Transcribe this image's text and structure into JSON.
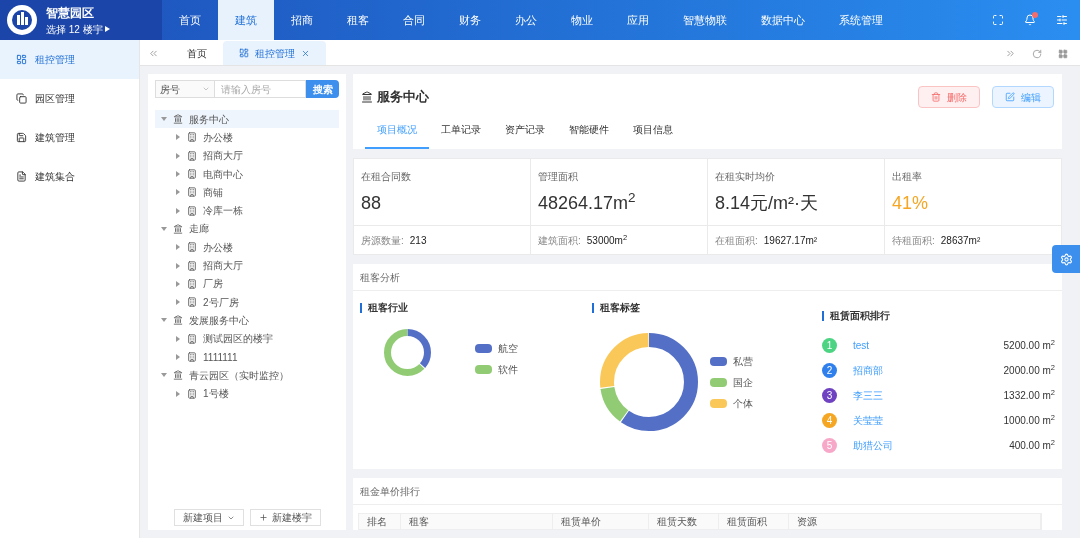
{
  "app": {
    "title": "智慧园区",
    "subtitle": "选择 12 楼宇"
  },
  "top_nav": [
    {
      "label": "首页",
      "selected": false
    },
    {
      "label": "建筑",
      "selected": true
    },
    {
      "label": "招商",
      "selected": false
    },
    {
      "label": "租客",
      "selected": false
    },
    {
      "label": "合同",
      "selected": false
    },
    {
      "label": "财务",
      "selected": false
    },
    {
      "label": "办公",
      "selected": false
    },
    {
      "label": "物业",
      "selected": false
    },
    {
      "label": "应用",
      "selected": false
    },
    {
      "label": "智慧物联",
      "selected": false
    },
    {
      "label": "数据中心",
      "selected": false
    },
    {
      "label": "系统管理",
      "selected": false
    }
  ],
  "notification_dot": true,
  "sidebar": {
    "items": [
      {
        "label": "租控管理",
        "selected": true
      },
      {
        "label": "园区管理",
        "selected": false
      },
      {
        "label": "建筑管理",
        "selected": false
      },
      {
        "label": "建筑集合",
        "selected": false
      }
    ]
  },
  "page_tabs": [
    {
      "label": "首页",
      "selected": false,
      "closable": false
    },
    {
      "label": "租控管理",
      "selected": true,
      "closable": true
    }
  ],
  "tree_panel": {
    "search_type": "房号",
    "search_placeholder": "请输入房号",
    "search_button": "搜索",
    "tree": [
      {
        "label": "服务中心",
        "kind": "project",
        "expanded": true,
        "selected": true,
        "children": [
          {
            "label": "办公楼",
            "kind": "building",
            "expanded": false,
            "selected": false
          },
          {
            "label": "招商大厅",
            "kind": "building",
            "expanded": false,
            "selected": false
          },
          {
            "label": "电商中心",
            "kind": "building",
            "expanded": false,
            "selected": false
          },
          {
            "label": "商铺",
            "kind": "building",
            "expanded": false,
            "selected": false
          },
          {
            "label": "冷库一栋",
            "kind": "building",
            "expanded": false,
            "selected": false
          }
        ]
      },
      {
        "label": "走廊",
        "kind": "project",
        "expanded": true,
        "selected": false,
        "children": [
          {
            "label": "办公楼",
            "kind": "building",
            "expanded": false,
            "selected": false
          },
          {
            "label": "招商大厅",
            "kind": "building",
            "expanded": false,
            "selected": false
          },
          {
            "label": "厂房",
            "kind": "building",
            "expanded": false,
            "selected": false
          },
          {
            "label": "2号厂房",
            "kind": "building",
            "expanded": false,
            "selected": false
          }
        ]
      },
      {
        "label": "发展服务中心",
        "kind": "project",
        "expanded": true,
        "selected": false,
        "children": [
          {
            "label": "测试园区的楼宇",
            "kind": "building",
            "expanded": false,
            "selected": false
          },
          {
            "label": "1111111",
            "kind": "building",
            "expanded": false,
            "selected": false
          }
        ]
      },
      {
        "label": "青云园区（实时监控）",
        "kind": "project",
        "expanded": true,
        "selected": false,
        "children": [
          {
            "label": "1号楼",
            "kind": "building",
            "expanded": false,
            "selected": false
          }
        ]
      }
    ],
    "buttons": [
      {
        "label": "新建项目",
        "kind": "dropdown"
      },
      {
        "label": "新建楼宇",
        "kind": "add"
      }
    ]
  },
  "detail": {
    "title": "服务中心",
    "actions": [
      {
        "label": "删除",
        "kind": "danger"
      },
      {
        "label": "编辑",
        "kind": "primary"
      }
    ],
    "tabs": [
      {
        "label": "项目概况",
        "selected": true
      },
      {
        "label": "工单记录",
        "selected": false
      },
      {
        "label": "资产记录",
        "selected": false
      },
      {
        "label": "智能硬件",
        "selected": false
      },
      {
        "label": "项目信息",
        "selected": false
      }
    ],
    "stats": [
      {
        "label": "在租合同数",
        "value": "88",
        "highlight": false,
        "sub_label": "房源数量:",
        "sub_value": "213"
      },
      {
        "label": "管理面积",
        "value": "48264.17m$^{2}$",
        "highlight": false,
        "sub_label": "建筑面积:",
        "sub_value": "53000m$^{2}$"
      },
      {
        "label": "在租实时均价",
        "value": "8.14元/m²·天",
        "highlight": false,
        "sub_label": "在租面积:",
        "sub_value": "19627.17m²"
      },
      {
        "label": "出租率",
        "value": "41%",
        "highlight": true,
        "sub_label": "待租面积:",
        "sub_value": "28637m²"
      }
    ],
    "analysis": {
      "title": "租客分析",
      "industry": {
        "title": "租客行业",
        "legend": [
          {
            "label": "航空",
            "color": "#5470c6"
          },
          {
            "label": "软件",
            "color": "#91cc75"
          }
        ]
      },
      "tags": {
        "title": "租客标签",
        "legend": [
          {
            "label": "私营",
            "color": "#5470c6"
          },
          {
            "label": "国企",
            "color": "#91cc75"
          },
          {
            "label": "个体",
            "color": "#fac858"
          }
        ]
      },
      "ranking": {
        "title": "租赁面积排行",
        "items": [
          {
            "rank": "1",
            "name": "test",
            "area": "5200.00 m$^{2}$",
            "color": "#4cd482"
          },
          {
            "rank": "2",
            "name": "招商部",
            "area": "2000.00 m$^{2}$",
            "color": "#2f80ed"
          },
          {
            "rank": "3",
            "name": "李三三",
            "area": "1332.00 m$^{2}$",
            "color": "#6f42c1"
          },
          {
            "rank": "4",
            "name": "关莹莹",
            "area": "1000.00 m$^{2}$",
            "color": "#f5a623"
          },
          {
            "rank": "5",
            "name": "助猎公司",
            "area": "400.00 m$^{2}$",
            "color": "#f7a8c8"
          }
        ]
      }
    },
    "price_ranking": {
      "title": "租金单价排行",
      "columns": [
        "排名",
        "租客",
        "租赁单价",
        "租赁天数",
        "租赁面积",
        "资源"
      ]
    }
  }
}
